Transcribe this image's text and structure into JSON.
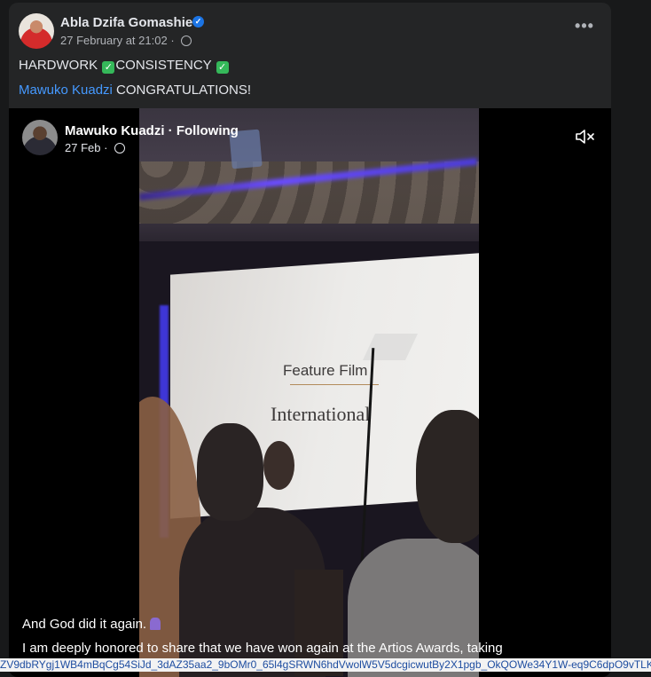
{
  "post": {
    "author": "Abla Dzifa Gomashie",
    "timestamp": "27 February at 21:02",
    "text_line1_part1": "HARDWORK ",
    "text_line1_part2": "CONSISTENCY ",
    "mention": "Mawuko Kuadzi",
    "text_line2_rest": " CONGRATULATIONS!",
    "more_label": "•••"
  },
  "shared": {
    "author": "Mawuko Kuadzi",
    "following_label": "Following",
    "timestamp": "27 Feb",
    "screen_text_1": "Feature Film",
    "screen_text_2": "International",
    "caption_line1": "And God did it again.",
    "caption_line2": "I am deeply honored to share that we have won again at the Artios Awards, taking"
  },
  "status_bar": {
    "url": "ZV9dbRYgj1WB4mBqCg54SiJd_3dAZ35aa2_9bOMr0_65l4gSRWN6hdVwolW5V5dcgicwutBy2X1pgb_OkQOWe34Y1W-eq9C6dpO9vTLKVs_8r"
  },
  "icons": {
    "verified": "verified-badge-icon",
    "globe": "globe-icon",
    "check": "check-mark-icon",
    "mute": "speaker-muted-icon",
    "pray": "folded-hands-icon"
  },
  "colors": {
    "background": "#18191a",
    "card": "#242526",
    "link": "#4599ff",
    "verified": "#1b74e4",
    "check": "#35b85a"
  }
}
